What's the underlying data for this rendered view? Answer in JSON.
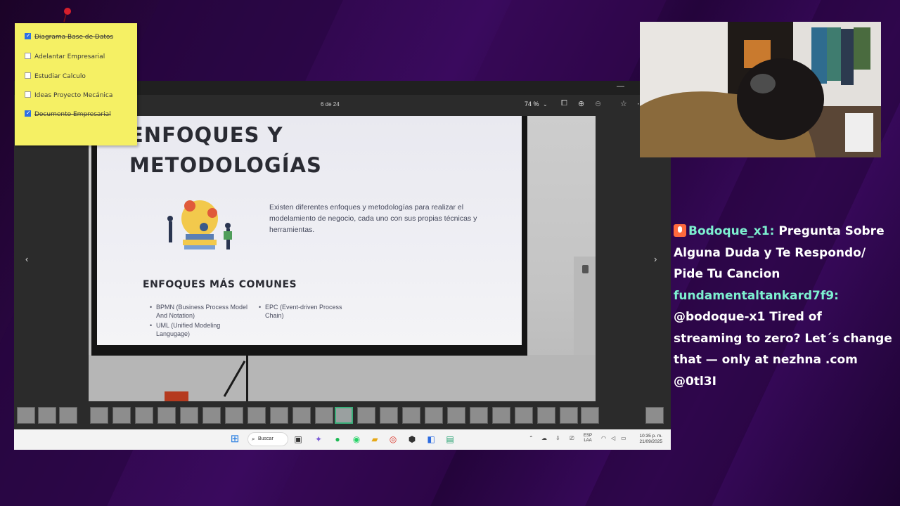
{
  "viewer": {
    "page_counter": "6 de 24",
    "zoom_level": "74 %"
  },
  "slide": {
    "title_line1": "ENFOQUES Y",
    "title_line2": "METODOLOGÍAS",
    "body": "Existen diferentes enfoques y metodologías para realizar el modelamiento de negocio, cada uno con sus propias técnicas y herramientas.",
    "subtitle": "ENFOQUES MÁS COMUNES",
    "bullets_left": [
      "BPMN (Business Process Model And Notation)",
      "UML (Unified Modeling Langugage)"
    ],
    "bullets_right": [
      "EPC (Event-driven Process Chain)"
    ]
  },
  "taskbar": {
    "search_label": "Buscar",
    "lang_line1": "ESP",
    "lang_line2": "LAA",
    "time": "10:35 p. m.",
    "date": "21/09/2025"
  },
  "sticky_note": {
    "tasks": [
      {
        "label": "Diagrama Base de Datos",
        "checked": true
      },
      {
        "label": "Adelantar Empresarial",
        "checked": false
      },
      {
        "label": "Estudiar Calculo",
        "checked": false
      },
      {
        "label": "Ideas Proyecto Mecánica",
        "checked": false
      },
      {
        "label": "Documento Empresarial",
        "checked": true
      }
    ]
  },
  "chat": {
    "messages": [
      {
        "user": "Bodoque_x1",
        "text": "Pregunta Sobre Alguna Duda y Te Respondo/ Pide Tu Cancion"
      },
      {
        "user": "fundamentaltankard7f9",
        "text": "@bodoque-x1 Tired of streaming to zero? Let´s change that — only at nezhna .com @0tl3I"
      }
    ]
  },
  "colors": {
    "background": "#2d0748",
    "sticky": "#f5f064",
    "chat_username": "#7df0d0",
    "chat_text": "#ffffff"
  }
}
